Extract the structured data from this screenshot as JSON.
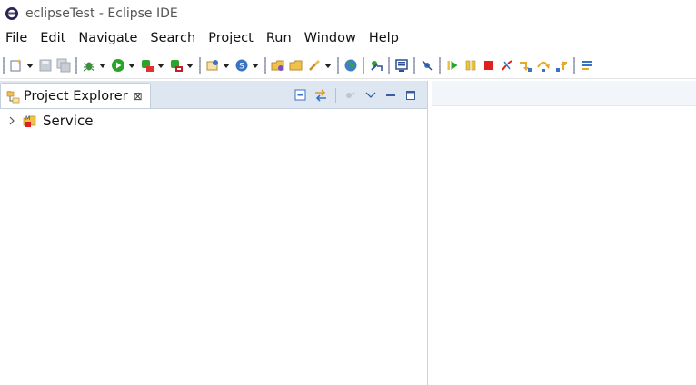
{
  "window": {
    "title": "eclipseTest - Eclipse IDE"
  },
  "menubar": {
    "items": [
      {
        "label": "File"
      },
      {
        "label": "Edit"
      },
      {
        "label": "Navigate"
      },
      {
        "label": "Search"
      },
      {
        "label": "Project"
      },
      {
        "label": "Run"
      },
      {
        "label": "Window"
      },
      {
        "label": "Help"
      }
    ]
  },
  "toolbar": {
    "icons": [
      "new-icon",
      "save-icon",
      "save-all-icon",
      "debug-icon",
      "run-icon",
      "coverage-icon",
      "external-tools-icon",
      "new-java-package-icon",
      "new-java-class-icon",
      "open-type-icon",
      "open-task-icon",
      "search-icon",
      "web-browser-icon",
      "launch-icon",
      "console-icon",
      "skip-breakpoints-icon",
      "resume-icon",
      "suspend-icon",
      "terminate-icon",
      "disconnect-icon",
      "step-into-icon",
      "step-over-icon",
      "step-return-icon",
      "use-step-filters-icon"
    ]
  },
  "project_explorer": {
    "tab_label": "Project Explorer",
    "tab_close": "⊠",
    "tree": [
      {
        "label": "Service",
        "expanded": false
      }
    ]
  },
  "colors": {
    "accent_blue": "#3b73c4",
    "run_green": "#2aa52a",
    "stop_red": "#e02020",
    "tab_bar": "#dde6f1"
  }
}
